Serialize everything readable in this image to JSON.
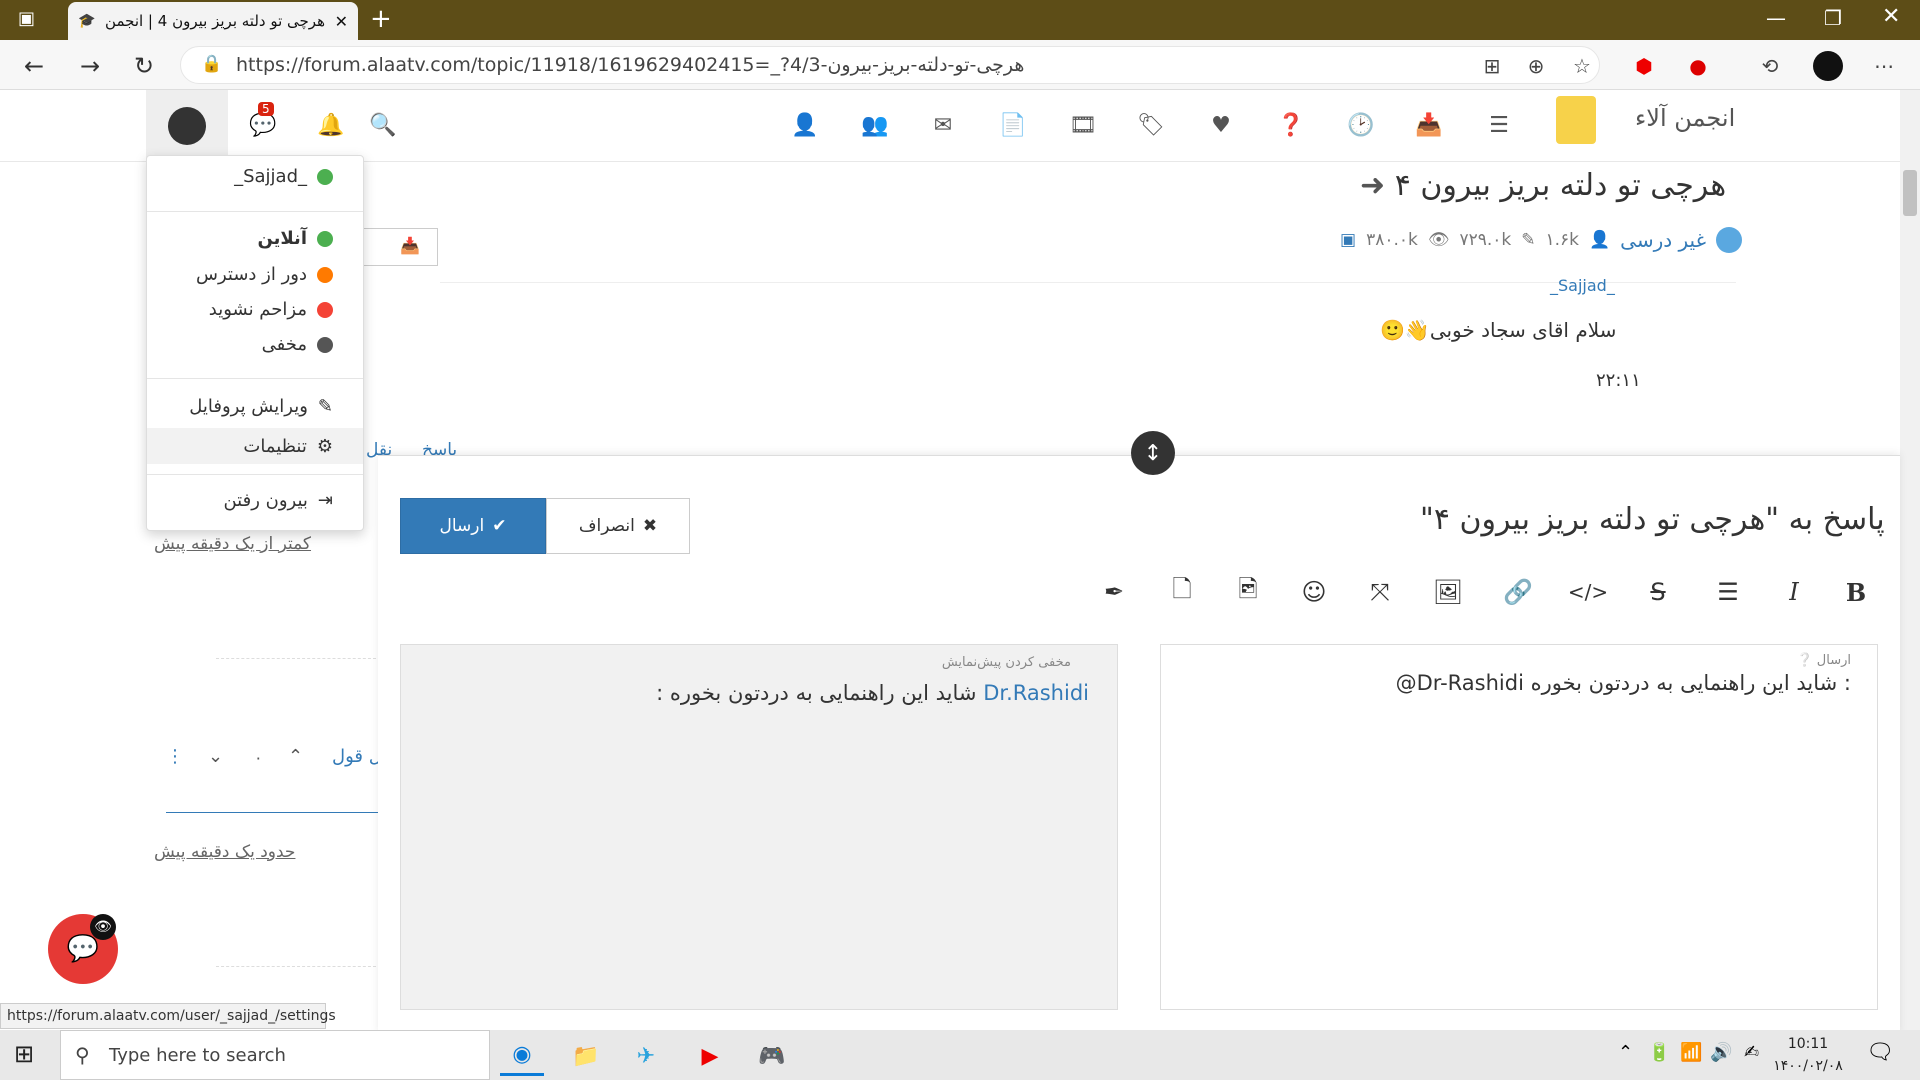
{
  "browser": {
    "tab_title": "هرچی تو دلته بریز بیرون 4 | انجمن",
    "url": "https://forum.alaatv.com/topic/11918/1619629402415=_?4/3-هرچی-تو-دلته-بریز-بیرون",
    "status_url": "https://forum.alaatv.com/user/_sajjad_/settings"
  },
  "header": {
    "brand": "انجمن آلاء",
    "notification_count": "5"
  },
  "topic": {
    "title": "هرچی تو دلته بریز بیرون ۴",
    "category": "غیر درسی",
    "posters": "۱.۶k",
    "posts": "۷۲۹.۰k",
    "views": "۳۸۰.۰k",
    "partial_author": "_Sajjad_",
    "message": "سلام اقای سجاد خوبی",
    "time": "۲۲:۱۱",
    "reply_link": "پاسخ",
    "quote_link": "نقل",
    "quote_link2": "نقل قول",
    "vote_count": "۰",
    "time_ago_1": "کمتر از یک دقیقه پیش",
    "time_ago_2": "حدود یک دقیقه پیش"
  },
  "dropdown": {
    "username": "_Sajjad_",
    "status_online": "آنلاین",
    "status_away": "دور از دسترس",
    "status_dnd": "مزاحم نشوید",
    "status_invisible": "مخفی",
    "edit_profile": "ویرایش پروفایل",
    "settings": "تنظیمات",
    "logout": "بیرون رفتن"
  },
  "composer": {
    "title": "پاسخ به \"هرچی تو دلته بریز بیرون ۴\"",
    "send_label": "ارسال",
    "cancel_label": "انصراف",
    "editor_help": "ارسال",
    "editor_text": "@Dr-Rashidi شاید این راهنمایی به دردتون بخوره :",
    "preview_hide": "مخفی کردن پیش‌نمایش",
    "preview_mention": "Dr.Rashidi",
    "preview_text": " شاید این راهنمایی به دردتون بخوره :"
  },
  "taskbar": {
    "search_placeholder": "Type here to search",
    "time": "10:11",
    "date": "۱۴۰۰/۰۲/۰۸"
  },
  "colors": {
    "titlebar": "#5d4d17",
    "primary": "#337ab7",
    "online": "#4caf50",
    "away": "#ff7a00",
    "dnd": "#f44336",
    "invisible": "#555555"
  }
}
